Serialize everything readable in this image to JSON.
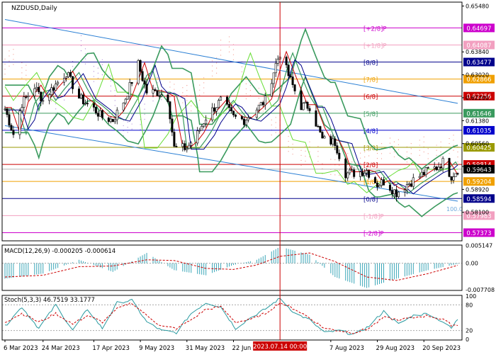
{
  "header": {
    "symbol_label": "NZDUSD,Daily"
  },
  "colors": {
    "background": "#ffffff",
    "pane_border": "#000000",
    "grid": "#c0c0c0",
    "bull_candle": "#ffffff",
    "bear_candle": "#000000",
    "candle_wick": "#000000",
    "envelope": "#3a9a5e",
    "lime_line": "#66dd33",
    "red_line": "#cc0000",
    "navy_line": "#00008b",
    "blue_channel": "#2a7fd4",
    "cloud_red": "#f08070",
    "cloud_purple": "#9966cc",
    "vline": "#cc0000",
    "macd_hist": "#3aa6b8",
    "macd_signal": "#cc0000",
    "stoch_main": "#2a9aa0",
    "stoch_signal": "#cc0000"
  },
  "price_axis": {
    "ticks": [
      "0.65480",
      "0.63840",
      "0.63020",
      "0.62200",
      "0.61380",
      "0.60560",
      "0.59740",
      "0.58920",
      "0.58100"
    ]
  },
  "murrey_levels": [
    {
      "label": "[+2/8]P",
      "price": 0.64697,
      "tag": "0.64697",
      "color": "#cc00cc"
    },
    {
      "label": "[+1/8]P",
      "price": 0.64087,
      "tag": "0.64087",
      "color": "#f2a0c0"
    },
    {
      "label": "[8/8]",
      "price": 0.63477,
      "tag": "0.63477",
      "color": "#00008b"
    },
    {
      "label": "[7/8]",
      "price": 0.62866,
      "tag": "0.62866",
      "color": "#f0a000"
    },
    {
      "label": "[6/8]",
      "price": 0.62256,
      "tag": "0.62256",
      "color": "#cc0000"
    },
    {
      "label": "[5/8]",
      "price": 0.61646,
      "tag": "0.61646",
      "color": "#3a9a5e"
    },
    {
      "label": "[4/8]",
      "price": 0.61035,
      "tag": "0.61035",
      "color": "#0000cc"
    },
    {
      "label": "[3/8]",
      "price": 0.60425,
      "tag": "0.60425",
      "color": "#9a9a00"
    },
    {
      "label": "[2/8]",
      "price": 0.59814,
      "tag": "0.59814",
      "color": "#cc0000"
    },
    {
      "label": "[1/8]",
      "price": 0.59204,
      "tag": "0.59204",
      "color": "#f0a000"
    },
    {
      "label": "[0/8]",
      "price": 0.58594,
      "tag": "0.58594",
      "color": "#00008b"
    },
    {
      "label": "[-1/8]P",
      "price": 0.57983,
      "tag": "0.57983",
      "color": "#f2a0c0"
    },
    {
      "label": "[-2/8]P",
      "price": 0.57373,
      "tag": "0.57373",
      "color": "#cc00cc"
    }
  ],
  "current_price": {
    "price": 0.59643,
    "tag": "0.59643",
    "color": "#000000"
  },
  "annotation_100": "100.0",
  "vertical_marker_label": "2023.07.14 00:00",
  "macd": {
    "label": "MACD(12,26,9) -0.000205 -0.000614",
    "ticks": [
      "0.005147",
      "0.00",
      "-0.007708"
    ]
  },
  "stoch": {
    "label": "Stoch(5,3,3) 46.7519 33.1777",
    "ticks": [
      "100",
      "80",
      "20",
      "0"
    ]
  },
  "date_axis": [
    "6 Mar 2023",
    "24 Mar 2023",
    "17 Apr 2023",
    "9 May 2023",
    "31 May 2023",
    "22 Jun",
    "7 Aug 2023",
    "29 Aug 2023",
    "20 Sep 2023"
  ],
  "chart_data": {
    "type": "candlestick",
    "title": "NZDUSD,Daily",
    "x_start": "2023-03-06",
    "x_end": "2023-10-06",
    "ylim": [
      0.5708,
      0.6562
    ],
    "marker_date": "2023-07-14",
    "close_path": [
      [
        "2023-03-06",
        0.618
      ],
      [
        "2023-03-10",
        0.609
      ],
      [
        "2023-03-14",
        0.62
      ],
      [
        "2023-03-20",
        0.626
      ],
      [
        "2023-03-24",
        0.621
      ],
      [
        "2023-03-28",
        0.625
      ],
      [
        "2023-04-04",
        0.631
      ],
      [
        "2023-04-10",
        0.622
      ],
      [
        "2023-04-17",
        0.618
      ],
      [
        "2023-04-21",
        0.615
      ],
      [
        "2023-04-26",
        0.614
      ],
      [
        "2023-05-02",
        0.622
      ],
      [
        "2023-05-08",
        0.634
      ],
      [
        "2023-05-12",
        0.624
      ],
      [
        "2023-05-17",
        0.624
      ],
      [
        "2023-05-22",
        0.622
      ],
      [
        "2023-05-25",
        0.604
      ],
      [
        "2023-05-31",
        0.604
      ],
      [
        "2023-06-05",
        0.609
      ],
      [
        "2023-06-09",
        0.615
      ],
      [
        "2023-06-16",
        0.621
      ],
      [
        "2023-06-22",
        0.615
      ],
      [
        "2023-06-27",
        0.614
      ],
      [
        "2023-07-03",
        0.618
      ],
      [
        "2023-07-07",
        0.621
      ],
      [
        "2023-07-12",
        0.634
      ],
      [
        "2023-07-14",
        0.638
      ],
      [
        "2023-07-18",
        0.63
      ],
      [
        "2023-07-24",
        0.619
      ],
      [
        "2023-07-28",
        0.619
      ],
      [
        "2023-08-03",
        0.607
      ],
      [
        "2023-08-09",
        0.606
      ],
      [
        "2023-08-14",
        0.595
      ],
      [
        "2023-08-18",
        0.595
      ],
      [
        "2023-08-24",
        0.596
      ],
      [
        "2023-08-29",
        0.591
      ],
      [
        "2023-09-01",
        0.592
      ],
      [
        "2023-09-07",
        0.588
      ],
      [
        "2023-09-12",
        0.591
      ],
      [
        "2023-09-18",
        0.594
      ],
      [
        "2023-09-22",
        0.596
      ],
      [
        "2023-09-26",
        0.597
      ],
      [
        "2023-09-29",
        0.599
      ],
      [
        "2023-10-03",
        0.594
      ],
      [
        "2023-10-06",
        0.5964
      ]
    ],
    "macd_histogram": [
      [
        "2023-03-06",
        -0.0045
      ],
      [
        "2023-03-24",
        -0.003
      ],
      [
        "2023-04-10",
        0.001
      ],
      [
        "2023-04-26",
        -0.0025
      ],
      [
        "2023-05-12",
        0.003
      ],
      [
        "2023-05-25",
        -0.002
      ],
      [
        "2023-06-09",
        -0.0035
      ],
      [
        "2023-06-22",
        -0.0005
      ],
      [
        "2023-07-03",
        0.001
      ],
      [
        "2023-07-14",
        0.0048
      ],
      [
        "2023-07-28",
        0.0025
      ],
      [
        "2023-08-09",
        -0.004
      ],
      [
        "2023-08-24",
        -0.0072
      ],
      [
        "2023-09-07",
        -0.0045
      ],
      [
        "2023-09-22",
        -0.002
      ],
      [
        "2023-10-06",
        -0.000205
      ]
    ],
    "macd_signal": [
      [
        "2023-03-06",
        -0.004
      ],
      [
        "2023-03-24",
        -0.0035
      ],
      [
        "2023-04-10",
        -0.001
      ],
      [
        "2023-04-26",
        -0.0008
      ],
      [
        "2023-05-12",
        0.001
      ],
      [
        "2023-05-25",
        0.0008
      ],
      [
        "2023-06-09",
        -0.0015
      ],
      [
        "2023-06-22",
        -0.0018
      ],
      [
        "2023-07-03",
        -0.0005
      ],
      [
        "2023-07-14",
        0.002
      ],
      [
        "2023-07-28",
        0.003
      ],
      [
        "2023-08-09",
        0.0005
      ],
      [
        "2023-08-24",
        -0.004
      ],
      [
        "2023-09-07",
        -0.005
      ],
      [
        "2023-09-22",
        -0.003
      ],
      [
        "2023-10-06",
        -0.000614
      ]
    ],
    "stoch_main": [
      [
        "2023-03-06",
        30
      ],
      [
        "2023-03-14",
        75
      ],
      [
        "2023-03-22",
        25
      ],
      [
        "2023-03-30",
        80
      ],
      [
        "2023-04-07",
        20
      ],
      [
        "2023-04-14",
        70
      ],
      [
        "2023-04-21",
        25
      ],
      [
        "2023-04-28",
        85
      ],
      [
        "2023-05-05",
        90
      ],
      [
        "2023-05-12",
        40
      ],
      [
        "2023-05-19",
        20
      ],
      [
        "2023-05-26",
        15
      ],
      [
        "2023-06-02",
        60
      ],
      [
        "2023-06-09",
        85
      ],
      [
        "2023-06-16",
        75
      ],
      [
        "2023-06-23",
        25
      ],
      [
        "2023-06-30",
        50
      ],
      [
        "2023-07-07",
        70
      ],
      [
        "2023-07-14",
        95
      ],
      [
        "2023-07-21",
        60
      ],
      [
        "2023-07-28",
        45
      ],
      [
        "2023-08-04",
        15
      ],
      [
        "2023-08-11",
        20
      ],
      [
        "2023-08-18",
        10
      ],
      [
        "2023-08-25",
        30
      ],
      [
        "2023-09-01",
        65
      ],
      [
        "2023-09-08",
        35
      ],
      [
        "2023-09-15",
        55
      ],
      [
        "2023-09-22",
        60
      ],
      [
        "2023-09-29",
        40
      ],
      [
        "2023-10-03",
        25
      ],
      [
        "2023-10-06",
        46.75
      ]
    ],
    "stoch_signal": [
      [
        "2023-03-06",
        40
      ],
      [
        "2023-03-14",
        60
      ],
      [
        "2023-03-22",
        40
      ],
      [
        "2023-03-30",
        60
      ],
      [
        "2023-04-07",
        35
      ],
      [
        "2023-04-14",
        55
      ],
      [
        "2023-04-21",
        40
      ],
      [
        "2023-04-28",
        70
      ],
      [
        "2023-05-05",
        85
      ],
      [
        "2023-05-12",
        55
      ],
      [
        "2023-05-19",
        30
      ],
      [
        "2023-05-26",
        25
      ],
      [
        "2023-06-02",
        45
      ],
      [
        "2023-06-09",
        70
      ],
      [
        "2023-06-16",
        75
      ],
      [
        "2023-06-23",
        40
      ],
      [
        "2023-06-30",
        45
      ],
      [
        "2023-07-07",
        60
      ],
      [
        "2023-07-14",
        85
      ],
      [
        "2023-07-21",
        70
      ],
      [
        "2023-07-28",
        50
      ],
      [
        "2023-08-04",
        25
      ],
      [
        "2023-08-11",
        20
      ],
      [
        "2023-08-18",
        15
      ],
      [
        "2023-08-25",
        25
      ],
      [
        "2023-09-01",
        50
      ],
      [
        "2023-09-08",
        45
      ],
      [
        "2023-09-15",
        50
      ],
      [
        "2023-09-22",
        55
      ],
      [
        "2023-09-29",
        45
      ],
      [
        "2023-10-03",
        33
      ],
      [
        "2023-10-06",
        33.18
      ]
    ]
  }
}
